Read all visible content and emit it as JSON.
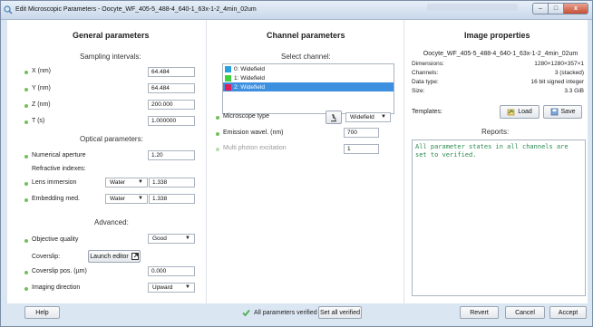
{
  "window": {
    "title": "Edit Microscopic Parameters - Oocyte_WF_405-5_488-4_640-1_63x-1-2_4min_02um",
    "buttons": {
      "minimize": "–",
      "maximize": "□",
      "close": "x"
    }
  },
  "general": {
    "title": "General parameters",
    "sampling_title": "Sampling intervals:",
    "sampling": [
      {
        "label": "X (nm)",
        "value": "64.484"
      },
      {
        "label": "Y (nm)",
        "value": "64.484"
      },
      {
        "label": "Z (nm)",
        "value": "200.000"
      },
      {
        "label": "T (s)",
        "value": "1.000000"
      }
    ],
    "optical_title": "Optical parameters:",
    "numerical_aperture": {
      "label": "Numerical aperture",
      "value": "1.20"
    },
    "refractive_label": "Refractive indexes:",
    "lens_immersion": {
      "label": "Lens immersion",
      "medium": "Water",
      "value": "1.338"
    },
    "embedding": {
      "label": "Embedding med.",
      "medium": "Water",
      "value": "1.338"
    },
    "advanced_title": "Advanced:",
    "objective_quality": {
      "label": "Objective quality",
      "value": "Good"
    },
    "coverslip": {
      "label": "Coverslip:",
      "button": "Launch editor"
    },
    "coverslip_pos": {
      "label": "Coverslip pos. (µm)",
      "value": "0.000"
    },
    "imaging_direction": {
      "label": "Imaging direction",
      "value": "Upward"
    }
  },
  "channel": {
    "title": "Channel parameters",
    "select_label": "Select channel:",
    "channels": [
      {
        "label": "0: Widefield",
        "color": "#2a9fe0"
      },
      {
        "label": "1: Widefield",
        "color": "#3fd13f"
      },
      {
        "label": "2: Widefield",
        "color": "#e01e5a"
      }
    ],
    "microscope_type": {
      "label": "Microscope type",
      "value": "Widefield"
    },
    "emission": {
      "label": "Emission wavel. (nm)",
      "value": "700"
    },
    "multiphoton": {
      "label": "Multi photon excitation",
      "value": "1"
    }
  },
  "image": {
    "title": "Image properties",
    "filename": "Oocyte_WF_405-5_488-4_640-1_63x-1-2_4min_02um",
    "props": [
      {
        "key": "Dimensions:",
        "value": "1280×1280×357×1"
      },
      {
        "key": "Channels:",
        "value": "3 (stacked)"
      },
      {
        "key": "Data type:",
        "value": "16 bit signed integer"
      },
      {
        "key": "Size:",
        "value": "3.3 GiB"
      }
    ],
    "templates_label": "Templates:",
    "load": "Load",
    "save": "Save",
    "reports_label": "Reports:",
    "report_text": "All parameter states in all channels are set to verified."
  },
  "bottom": {
    "help": "Help",
    "verified_text": "All parameters verified",
    "set_all_verified": "Set all verified",
    "revert": "Revert",
    "cancel": "Cancel",
    "accept": "Accept"
  },
  "colors": {
    "accent_selection": "#3d8fe0",
    "verified_dot": "#72c05c",
    "report_text": "#2b8a50"
  }
}
